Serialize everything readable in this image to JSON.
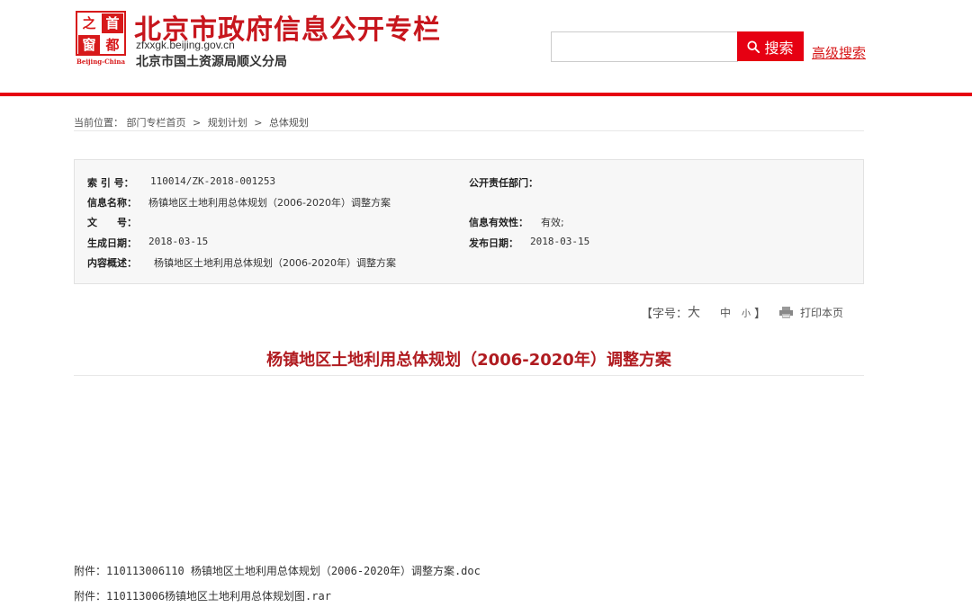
{
  "header": {
    "logo": {
      "chars": [
        "之",
        "首",
        "窗",
        "都"
      ],
      "subtitle": "Beijing-China"
    },
    "title": "北京市政府信息公开专栏",
    "domain": "zfxxgk.beijing.gov.cn",
    "department": "北京市国土资源局顺义分局",
    "search": {
      "placeholder": "",
      "value": "",
      "button_label": "搜索"
    },
    "advanced_search": "高级搜索"
  },
  "breadcrumb": {
    "prefix": "当前位置：",
    "items": [
      "部门专栏首页",
      "规划计划",
      "总体规划"
    ],
    "separator": ">"
  },
  "info": {
    "index_label": "索 引 号：",
    "index_value": "110014/ZK-2018-001253",
    "dept_label": "公开责任部门：",
    "dept_value": "",
    "name_label": "信息名称：",
    "name_value": "杨镇地区土地利用总体规划（2006-2020年）调整方案",
    "doc_no_label": "文　　号：",
    "doc_no_value": "",
    "validity_label": "信息有效性：",
    "validity_value": "有效;",
    "created_label": "生成日期：",
    "created_value": "2018-03-15",
    "published_label": "发布日期：",
    "published_value": "2018-03-15",
    "summary_label": "内容概述：",
    "summary_value": "杨镇地区土地利用总体规划（2006-2020年）调整方案"
  },
  "toolbar": {
    "font_size_prefix": "【字号：",
    "font_size_large": "大",
    "font_size_medium": "中",
    "font_size_small": "小",
    "font_size_suffix": "】",
    "print_label": "打印本页"
  },
  "document": {
    "title": "杨镇地区土地利用总体规划（2006-2020年）调整方案"
  },
  "attachments": [
    {
      "label": "附件：",
      "file": "110113006110 杨镇地区土地利用总体规划（2006-2020年）调整方案.doc"
    },
    {
      "label": "附件：",
      "file": "110113006杨镇地区土地利用总体规划图.rar"
    }
  ],
  "colors": {
    "brand_red": "#e60012",
    "title_red": "#b01b20"
  }
}
